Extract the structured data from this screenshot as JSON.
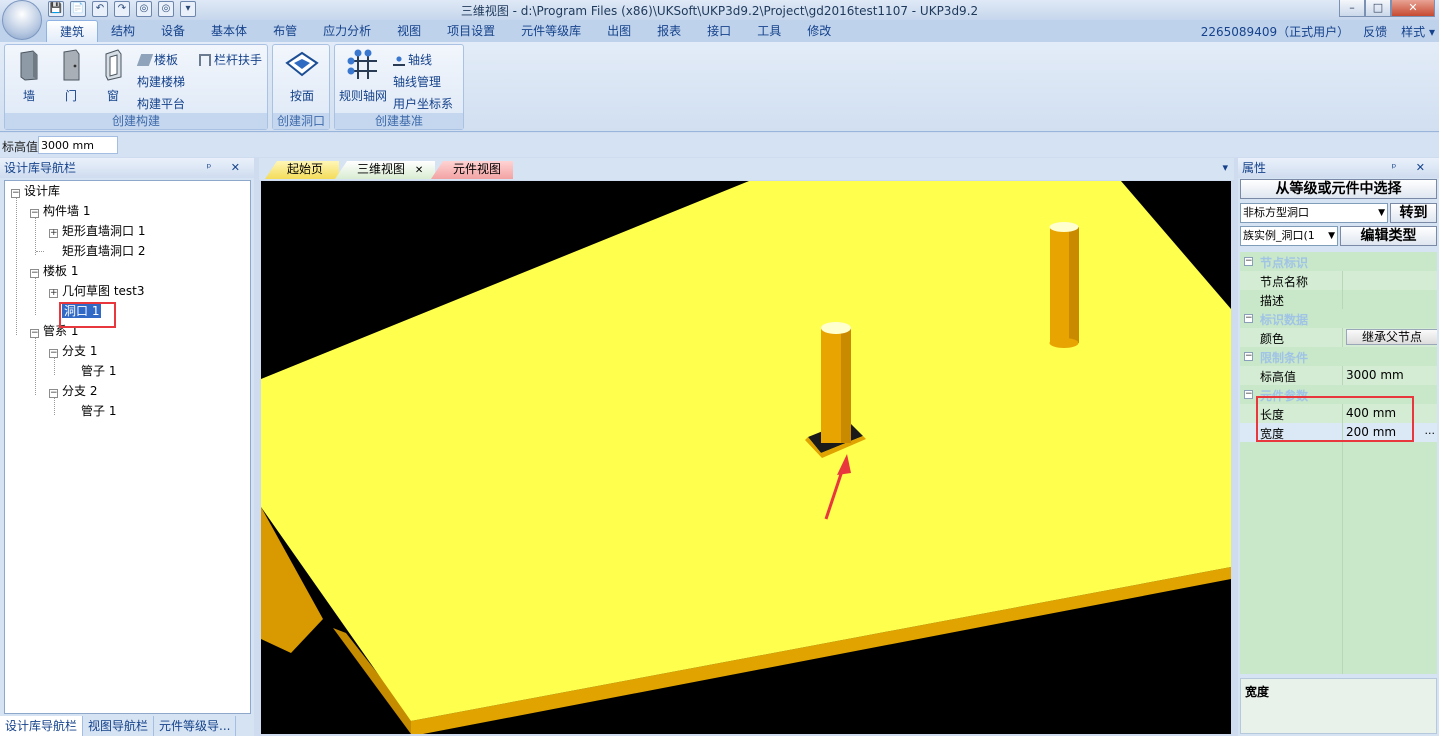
{
  "window": {
    "title": "三维视图 - d:\\Program Files (x86)\\UKSoft\\UKP3d9.2\\Project\\gd2016test1107 - UKP3d9.2",
    "controls": [
      "–",
      "□",
      "✕"
    ]
  },
  "qat": [
    "💾",
    "📄",
    "↶",
    "↷",
    "◎",
    "◎",
    "▾"
  ],
  "ribbon_tabs": [
    "建筑",
    "结构",
    "设备",
    "基本体",
    "布管",
    "应力分析",
    "视图",
    "项目设置",
    "元件等级库",
    "出图",
    "报表",
    "接口",
    "工具",
    "修改"
  ],
  "ribbon_right": {
    "user": "2265089409（正式用户）",
    "feedback": "反馈",
    "style": "样式",
    "style_arrow": "▾"
  },
  "groups": {
    "build": {
      "label": "创建构建",
      "wall": "墙",
      "door": "门",
      "window": "窗",
      "slab": "楼板",
      "stair": "构建楼梯",
      "platform": "构建平台",
      "railing": "栏杆扶手"
    },
    "opening": {
      "label": "创建洞口",
      "face": "按面"
    },
    "datum": {
      "label": "创建基准",
      "grid": "规则轴网",
      "axis": "轴线",
      "axis_mgr": "轴线管理",
      "ucs": "用户坐标系"
    }
  },
  "elevation": {
    "label": "标高值",
    "value": "3000 mm"
  },
  "navigator": {
    "title": "设计库导航栏",
    "controls": "ᵖ ✕",
    "tree": [
      {
        "label": "设计库",
        "exp": "−"
      },
      {
        "label": "构件墙 1",
        "exp": "−"
      },
      {
        "label": "矩形直墙洞口 1",
        "exp": "+"
      },
      {
        "label": "矩形直墙洞口 2",
        "exp": ""
      },
      {
        "label": "楼板 1",
        "exp": "−"
      },
      {
        "label": "几何草图 test3",
        "exp": "+"
      },
      {
        "label": "洞口 1",
        "exp": ""
      },
      {
        "label": "管系 1",
        "exp": "−"
      },
      {
        "label": "分支 1",
        "exp": "−"
      },
      {
        "label": "管子 1",
        "exp": ""
      },
      {
        "label": "分支 2",
        "exp": "−"
      },
      {
        "label": "管子 1",
        "exp": ""
      }
    ],
    "bottom_tabs": [
      "设计库导航栏",
      "视图导航栏",
      "元件等级导..."
    ]
  },
  "doc_tabs": [
    {
      "label": "起始页",
      "close": ""
    },
    {
      "label": "三维视图",
      "close": "✕"
    },
    {
      "label": "元件视图",
      "close": ""
    }
  ],
  "doc_tabs_menu": "▾",
  "properties": {
    "title": "属性",
    "controls": "ᵖ ✕",
    "select_button": "从等级或元件中选择",
    "type_select": "非标方型洞口",
    "goto_button": "转到",
    "instance_select": "族实例_洞口(1",
    "edit_type_button": "编辑类型",
    "rows": [
      {
        "kind": "cat",
        "name": "节点标识"
      },
      {
        "kind": "prop",
        "name": "节点名称",
        "value": ""
      },
      {
        "kind": "prop",
        "name": "描述",
        "value": ""
      },
      {
        "kind": "cat",
        "name": "标识数据"
      },
      {
        "kind": "prop",
        "name": "颜色",
        "value": "继承父节点"
      },
      {
        "kind": "cat",
        "name": "限制条件"
      },
      {
        "kind": "prop",
        "name": "标高值",
        "value": "3000 mm"
      },
      {
        "kind": "cat",
        "name": "元件参数"
      },
      {
        "kind": "prop",
        "name": "长度",
        "value": "400 mm"
      },
      {
        "kind": "prop",
        "name": "宽度",
        "value": "200 mm"
      }
    ],
    "ellipsis": "...",
    "description_title": "宽度"
  },
  "colors": {
    "slab": "#ffff4d",
    "slab_edge": "#e0a300",
    "column": "#e8a400",
    "highlight": "#e8383d"
  }
}
